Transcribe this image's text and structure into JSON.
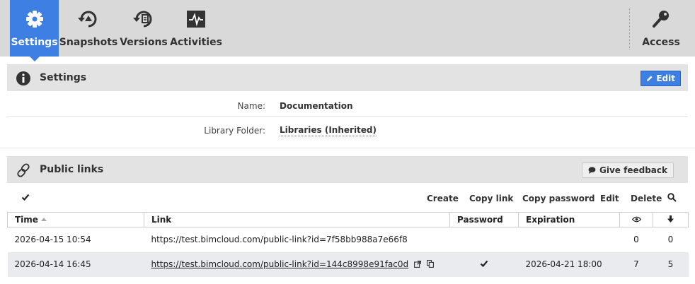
{
  "nav": {
    "tabs": [
      {
        "label": "Settings",
        "icon": "gear-icon",
        "active": true
      },
      {
        "label": "Snapshots",
        "icon": "snapshot-icon",
        "active": false
      },
      {
        "label": "Versions",
        "icon": "versions-icon",
        "active": false
      },
      {
        "label": "Activities",
        "icon": "activity-icon",
        "active": false
      }
    ],
    "access": {
      "label": "Access",
      "icon": "key-icon"
    }
  },
  "settings": {
    "title": "Settings",
    "edit_label": "Edit",
    "rows": [
      {
        "key": "Name:",
        "value": "Documentation"
      },
      {
        "key": "Library Folder:",
        "value": "Libraries (Inherited)"
      }
    ]
  },
  "public_links": {
    "title": "Public links",
    "feedback_label": "Give feedback",
    "actions": [
      "Create",
      "Copy link",
      "Copy password",
      "Edit",
      "Delete"
    ],
    "columns": [
      "Time",
      "Link",
      "Password",
      "Expiration",
      "views-icon",
      "downloads-icon"
    ],
    "rows": [
      {
        "time": "2026-04-15 10:54",
        "link": "https://test.bimcloud.com/public-link?id=7f58bb988a7e66f8",
        "password": false,
        "expiration": "",
        "views": "0",
        "downloads": "0"
      },
      {
        "time": "2026-04-14 16:45",
        "link": "https://test.bimcloud.com/public-link?id=144c8998e91fac0d",
        "password": true,
        "expiration": "2026-04-21 18:00",
        "views": "7",
        "downloads": "5"
      }
    ]
  },
  "colors": {
    "accent": "#3d7fe2",
    "nav_bg": "#d9d9d9",
    "section_bg": "#e3e3e3",
    "row_alt": "#e9ebef"
  }
}
